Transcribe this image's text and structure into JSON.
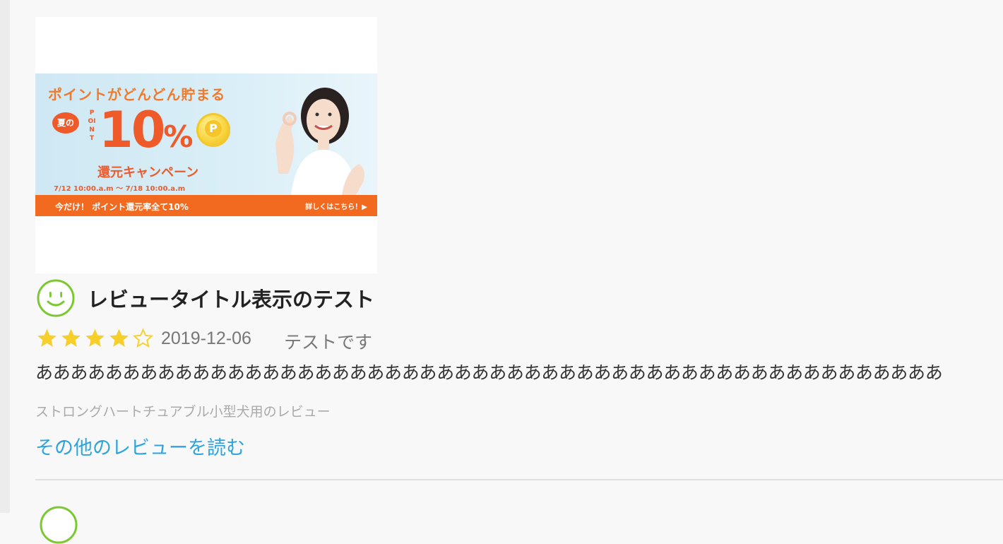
{
  "banner": {
    "headline": "ポイントがどんどん貯まる",
    "bubble": "夏の",
    "point_vertical": "POINT",
    "percent": "10",
    "percent_sign": "%",
    "campaign": "還元キャンペーン",
    "period": "7/12 10:00.a.m 〜 7/18 10:00.a.m",
    "strip_left": "今だけ！ ポイント還元率全て10%",
    "strip_right": "詳しくはこちら！▶",
    "coin_letter": "P"
  },
  "review": {
    "title": "レビュータイトル表示のテスト",
    "rating": 4,
    "max_rating": 5,
    "date": "2019-12-06",
    "reviewer": "テストです",
    "body": "ああああああああああああああああああああああああああああああああああああああああああああああああああああ",
    "product": "ストロングハートチュアブル小型犬用のレビュー",
    "more_link": "その他のレビューを読む"
  },
  "colors": {
    "smiley": "#7cc832",
    "star_filled": "#f7cf2a",
    "link": "#2da4dc",
    "banner_orange": "#ef5a2a"
  }
}
